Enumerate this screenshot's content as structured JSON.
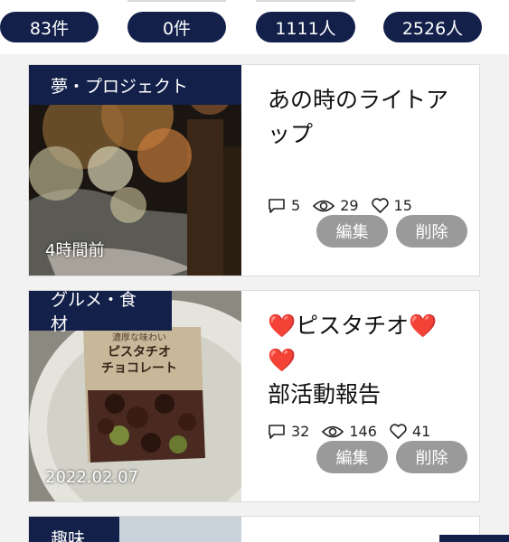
{
  "stats": [
    {
      "value": "83件"
    },
    {
      "value": "0件"
    },
    {
      "value": "1111人"
    },
    {
      "value": "2526人"
    }
  ],
  "posts": [
    {
      "category": "夢・プロジェクト",
      "time": "4時間前",
      "title": "あの時のライトアップ",
      "comments": "5",
      "views": "29",
      "likes": "15",
      "edit_label": "編集",
      "delete_label": "削除"
    },
    {
      "category": "グルメ・食材",
      "time": "2022.02.07",
      "title_pre": "❤️",
      "title_mid": "ピスタチオ",
      "title_hearts": "❤️❤️",
      "title_post": "部活動報告",
      "package_line1": "濃厚な味わい",
      "package_line2": "ピスタチオ",
      "package_line3": "チョコレート",
      "comments": "32",
      "views": "146",
      "likes": "41",
      "edit_label": "編集",
      "delete_label": "削除"
    },
    {
      "category": "趣味"
    }
  ],
  "colors": {
    "navy": "#13204a",
    "button_gray": "#9a9a9a",
    "heart_red": "#e0101a"
  },
  "icons": [
    "comment-icon",
    "eye-icon",
    "heart-icon"
  ]
}
